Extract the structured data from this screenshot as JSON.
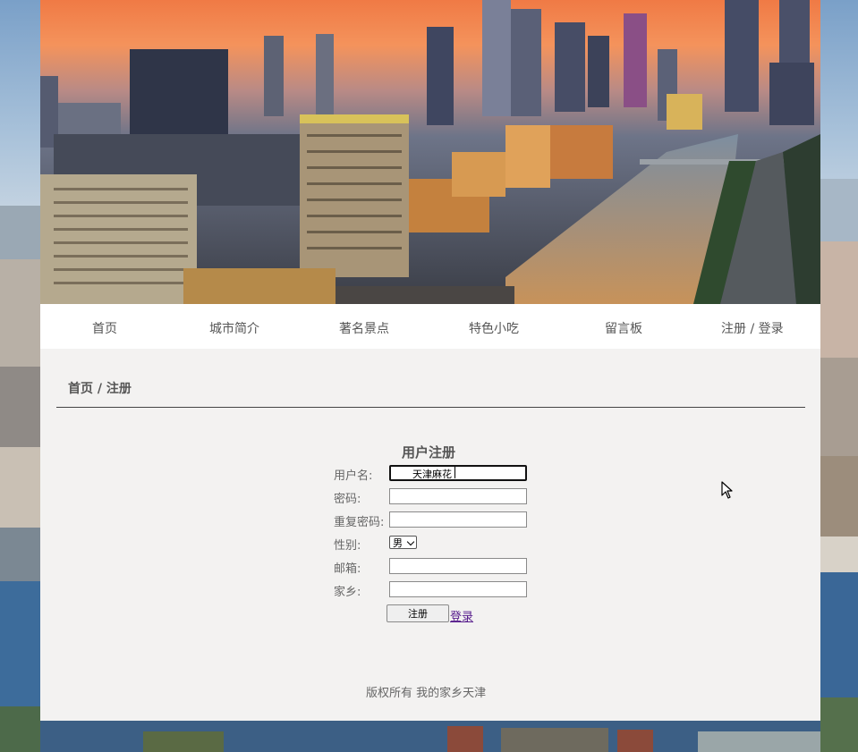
{
  "nav": {
    "items": [
      {
        "label": "首页"
      },
      {
        "label": "城市简介"
      },
      {
        "label": "著名景点"
      },
      {
        "label": "特色小吃"
      },
      {
        "label": "留言板"
      },
      {
        "label": "注册 / 登录"
      }
    ]
  },
  "breadcrumb": "首页 / 注册",
  "form": {
    "title": "用户注册",
    "username_label": "用户名:",
    "username_value": "天津麻花",
    "password_label": "密码:",
    "password_value": "",
    "repeat_password_label": "重复密码:",
    "repeat_password_value": "",
    "gender_label": "性别:",
    "gender_selected": "男",
    "email_label": "邮箱:",
    "email_value": "",
    "hometown_label": "家乡:",
    "hometown_value": "",
    "submit_label": "注册",
    "login_link": "登录"
  },
  "footer": "版权所有 我的家乡天津",
  "colors": {
    "page_bg": "#f3f2f1",
    "nav_bg": "#ffffff",
    "text": "#555555",
    "link_visited": "#551a8b"
  }
}
